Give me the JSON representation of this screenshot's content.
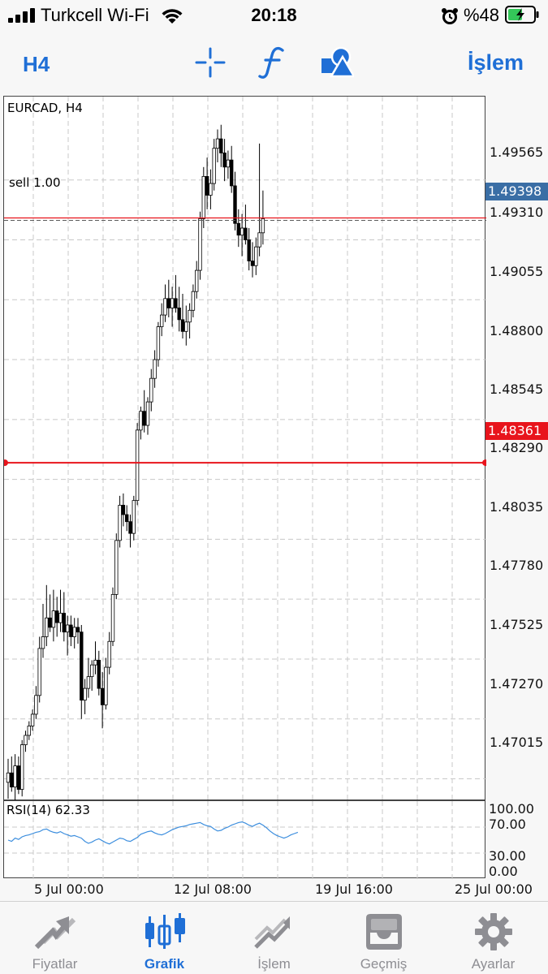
{
  "status": {
    "carrier": "Turkcell Wi-Fi",
    "time": "20:18",
    "battery": "%48"
  },
  "toolbar": {
    "timeframe": "H4",
    "trade_label": "İşlem",
    "icons": [
      "crosshair-icon",
      "function-icon",
      "objects-icon"
    ]
  },
  "chart": {
    "title": "EURCAD, H4",
    "sell_label": "sell 1.00",
    "current_price": "1.49398",
    "level_price": "1.48361",
    "current_color": "#3a6ea5",
    "level_color": "#e8141c",
    "rsi_title": "RSI(14) 62.33",
    "price_ticks": [
      "1.49565",
      "1.49310",
      "1.49055",
      "1.48800",
      "1.48545",
      "1.48290",
      "1.48035",
      "1.47780",
      "1.47525",
      "1.47270",
      "1.47015"
    ],
    "rsi_ticks": [
      "100.00",
      "70.00",
      "30.00",
      "0.00"
    ],
    "time_ticks": [
      "5 Jul 00:00",
      "12 Jul 08:00",
      "19 Jul 16:00",
      "25 Jul 00:00"
    ]
  },
  "chart_data": {
    "type": "candlestick",
    "title": "EURCAD, H4",
    "ylim": [
      1.4692,
      1.4992
    ],
    "grid": true,
    "candles": [
      [
        1.47,
        1.471,
        1.4693,
        1.4704
      ],
      [
        1.4704,
        1.4711,
        1.4696,
        1.4698
      ],
      [
        1.4698,
        1.4712,
        1.469,
        1.4707
      ],
      [
        1.4707,
        1.4711,
        1.4695,
        1.4697
      ],
      [
        1.4697,
        1.4718,
        1.4694,
        1.4716
      ],
      [
        1.4716,
        1.4722,
        1.4713,
        1.472
      ],
      [
        1.472,
        1.4726,
        1.4718,
        1.4724
      ],
      [
        1.4724,
        1.4731,
        1.4722,
        1.4729
      ],
      [
        1.4729,
        1.4741,
        1.4727,
        1.4737
      ],
      [
        1.4737,
        1.4762,
        1.4734,
        1.4757
      ],
      [
        1.4757,
        1.4776,
        1.4753,
        1.4762
      ],
      [
        1.4762,
        1.4784,
        1.4758,
        1.477
      ],
      [
        1.477,
        1.478,
        1.4764,
        1.4766
      ],
      [
        1.4766,
        1.4782,
        1.476,
        1.4773
      ],
      [
        1.4773,
        1.4779,
        1.4762,
        1.4768
      ],
      [
        1.4768,
        1.4782,
        1.4764,
        1.4772
      ],
      [
        1.4772,
        1.4781,
        1.476,
        1.4764
      ],
      [
        1.4764,
        1.4771,
        1.4754,
        1.4767
      ],
      [
        1.4767,
        1.4771,
        1.4758,
        1.4762
      ],
      [
        1.4762,
        1.477,
        1.4757,
        1.4766
      ],
      [
        1.4766,
        1.477,
        1.4759,
        1.4764
      ],
      [
        1.4764,
        1.4767,
        1.4727,
        1.4735
      ],
      [
        1.4735,
        1.4744,
        1.4729,
        1.474
      ],
      [
        1.474,
        1.4753,
        1.4736,
        1.4745
      ],
      [
        1.4745,
        1.4752,
        1.4739,
        1.475
      ],
      [
        1.475,
        1.476,
        1.4746,
        1.4752
      ],
      [
        1.4752,
        1.4756,
        1.4737,
        1.474
      ],
      [
        1.474,
        1.4747,
        1.4723,
        1.4733
      ],
      [
        1.4733,
        1.4753,
        1.4731,
        1.4749
      ],
      [
        1.4749,
        1.4764,
        1.4746,
        1.476
      ],
      [
        1.476,
        1.4783,
        1.4758,
        1.478
      ],
      [
        1.478,
        1.4806,
        1.4778,
        1.4803
      ],
      [
        1.4803,
        1.4822,
        1.48,
        1.4818
      ],
      [
        1.4818,
        1.4823,
        1.4809,
        1.4814
      ],
      [
        1.4814,
        1.4818,
        1.4807,
        1.4811
      ],
      [
        1.4811,
        1.4814,
        1.48,
        1.4806
      ],
      [
        1.4806,
        1.4822,
        1.4803,
        1.482
      ],
      [
        1.482,
        1.4853,
        1.4818,
        1.485
      ],
      [
        1.485,
        1.486,
        1.4846,
        1.4858
      ],
      [
        1.4858,
        1.4867,
        1.4849,
        1.4852
      ],
      [
        1.4852,
        1.4864,
        1.4848,
        1.4862
      ],
      [
        1.4862,
        1.4876,
        1.4858,
        1.4872
      ],
      [
        1.4872,
        1.4884,
        1.4868,
        1.488
      ],
      [
        1.488,
        1.4896,
        1.4877,
        1.4894
      ],
      [
        1.4894,
        1.4904,
        1.489,
        1.4899
      ],
      [
        1.4899,
        1.4912,
        1.4896,
        1.4906
      ],
      [
        1.4906,
        1.4914,
        1.4898,
        1.4902
      ],
      [
        1.4902,
        1.4911,
        1.4894,
        1.4906
      ],
      [
        1.4906,
        1.4916,
        1.49,
        1.4902
      ],
      [
        1.4902,
        1.4911,
        1.4892,
        1.4897
      ],
      [
        1.4897,
        1.4908,
        1.4889,
        1.4892
      ],
      [
        1.4892,
        1.4903,
        1.4886,
        1.4896
      ],
      [
        1.4896,
        1.4904,
        1.4889,
        1.4901
      ],
      [
        1.4901,
        1.4912,
        1.4898,
        1.4909
      ],
      [
        1.4909,
        1.4922,
        1.4906,
        1.4918
      ],
      [
        1.4918,
        1.4943,
        1.4914,
        1.494
      ],
      [
        1.494,
        1.4962,
        1.4936,
        1.4958
      ],
      [
        1.4958,
        1.4966,
        1.4944,
        1.495
      ],
      [
        1.495,
        1.4961,
        1.4944,
        1.4955
      ],
      [
        1.4955,
        1.4974,
        1.4952,
        1.497
      ],
      [
        1.497,
        1.4978,
        1.4964,
        1.4974
      ],
      [
        1.4974,
        1.498,
        1.4962,
        1.4968
      ],
      [
        1.4968,
        1.4974,
        1.4956,
        1.4962
      ],
      [
        1.4962,
        1.4969,
        1.4957,
        1.4965
      ],
      [
        1.4965,
        1.4971,
        1.4951,
        1.4954
      ],
      [
        1.4954,
        1.496,
        1.4935,
        1.4938
      ],
      [
        1.4938,
        1.4944,
        1.4928,
        1.4933
      ],
      [
        1.4933,
        1.4942,
        1.4924,
        1.4936
      ],
      [
        1.4936,
        1.4946,
        1.4929,
        1.4931
      ],
      [
        1.4931,
        1.4936,
        1.4918,
        1.4922
      ],
      [
        1.4922,
        1.493,
        1.4915,
        1.492
      ],
      [
        1.492,
        1.4932,
        1.4916,
        1.4928
      ],
      [
        1.4928,
        1.4972,
        1.4924,
        1.4934
      ],
      [
        1.4934,
        1.4952,
        1.4929,
        1.494
      ]
    ],
    "horizontal_lines": [
      {
        "label": "sell 1.00",
        "value": 1.49398
      },
      {
        "value": 1.48361
      }
    ],
    "rsi": {
      "name": "RSI(14)",
      "ylim": [
        0,
        100
      ],
      "levels": [
        30,
        70
      ],
      "values": [
        50,
        48,
        53,
        51,
        55,
        57,
        58,
        60,
        62,
        63,
        66,
        67,
        64,
        62,
        61,
        63,
        60,
        58,
        56,
        57,
        55,
        53,
        48,
        45,
        47,
        50,
        52,
        49,
        46,
        44,
        47,
        50,
        53,
        52,
        49,
        48,
        51,
        54,
        59,
        61,
        63,
        64,
        61,
        59,
        58,
        60,
        63,
        66,
        68,
        70,
        71,
        72,
        74,
        75,
        76,
        77,
        74,
        72,
        71,
        67,
        64,
        65,
        68,
        70,
        73,
        75,
        77,
        78,
        76,
        73,
        71,
        74,
        76,
        73,
        69,
        64,
        60,
        57,
        55,
        53,
        55,
        58,
        60,
        62
      ]
    }
  },
  "nav": [
    {
      "label": "Fiyatlar",
      "icon": "quotes-icon",
      "active": false
    },
    {
      "label": "Grafik",
      "icon": "chart-icon",
      "active": true
    },
    {
      "label": "İşlem",
      "icon": "trade-icon",
      "active": false
    },
    {
      "label": "Geçmiş",
      "icon": "history-icon",
      "active": false
    },
    {
      "label": "Ayarlar",
      "icon": "settings-icon",
      "active": false
    }
  ]
}
